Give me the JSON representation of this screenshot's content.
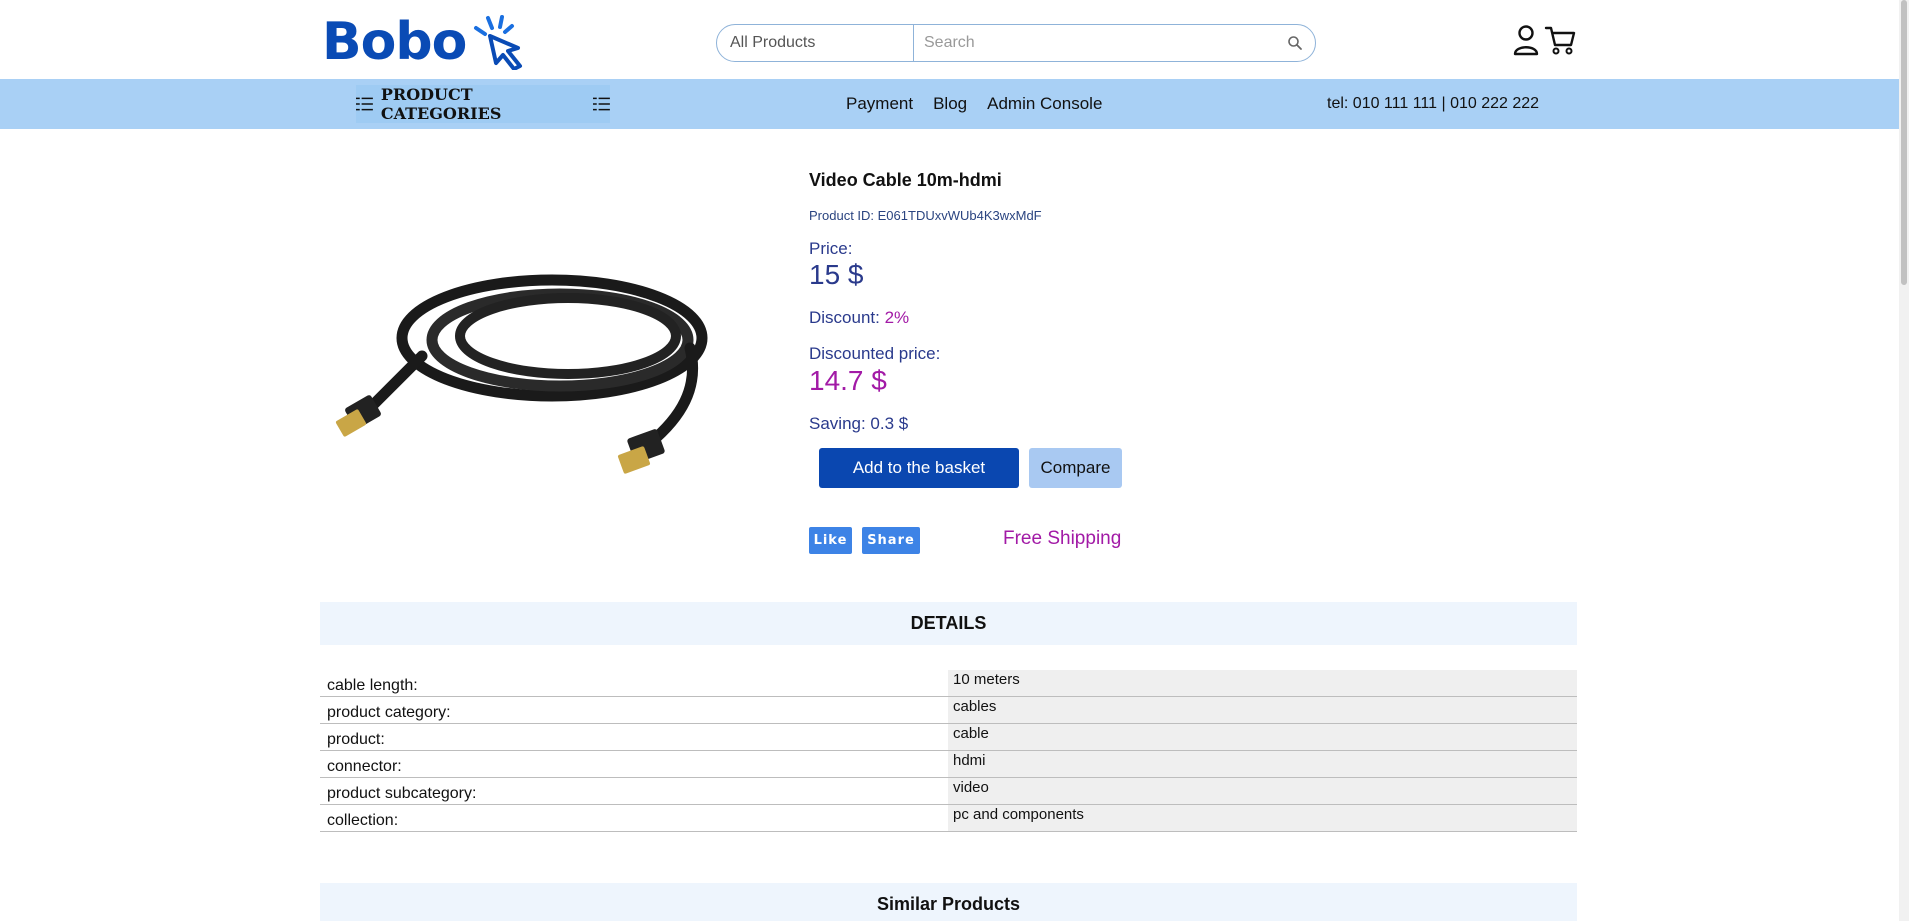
{
  "header": {
    "logo_text": "Bobo",
    "search": {
      "category": "All Products",
      "placeholder": "Search"
    }
  },
  "navbar": {
    "categories_label": "PRODUCT CATEGORIES",
    "links": [
      "Payment",
      "Blog",
      "Admin Console"
    ],
    "tel": "tel: 010 111 111 | 010 222 222"
  },
  "product": {
    "title": "Video Cable 10m-hdmi",
    "id_label": "Product ID: ",
    "id_value": "E061TDUxvWUb4K3wxMdF",
    "price_label": "Price:",
    "price_value": "15 $",
    "discount_label": "Discount: ",
    "discount_value": "2%",
    "discounted_price_label": "Discounted price:",
    "discounted_price_value": "14.7 $",
    "saving": "Saving: 0.3 $",
    "add_to_basket": "Add to the basket",
    "compare": "Compare",
    "like": "Like",
    "share": "Share",
    "free_shipping": "Free Shipping"
  },
  "details": {
    "heading": "DETAILS",
    "rows": [
      {
        "key": "cable length:",
        "value": "10 meters"
      },
      {
        "key": "product category:",
        "value": "cables"
      },
      {
        "key": "product:",
        "value": "cable"
      },
      {
        "key": "connector:",
        "value": "hdmi"
      },
      {
        "key": "product subcategory:",
        "value": "video"
      },
      {
        "key": "collection:",
        "value": "pc and components"
      }
    ]
  },
  "similar": {
    "heading": "Similar Products"
  },
  "colors": {
    "brand_blue": "#0a4bb5",
    "nav_bg": "#a9d0f5",
    "price_color": "#2a3a8c",
    "accent_magenta": "#a21aa6"
  },
  "icons": [
    "cursor-click-logo-icon",
    "search-icon",
    "user-icon",
    "cart-icon",
    "menu-icon"
  ]
}
